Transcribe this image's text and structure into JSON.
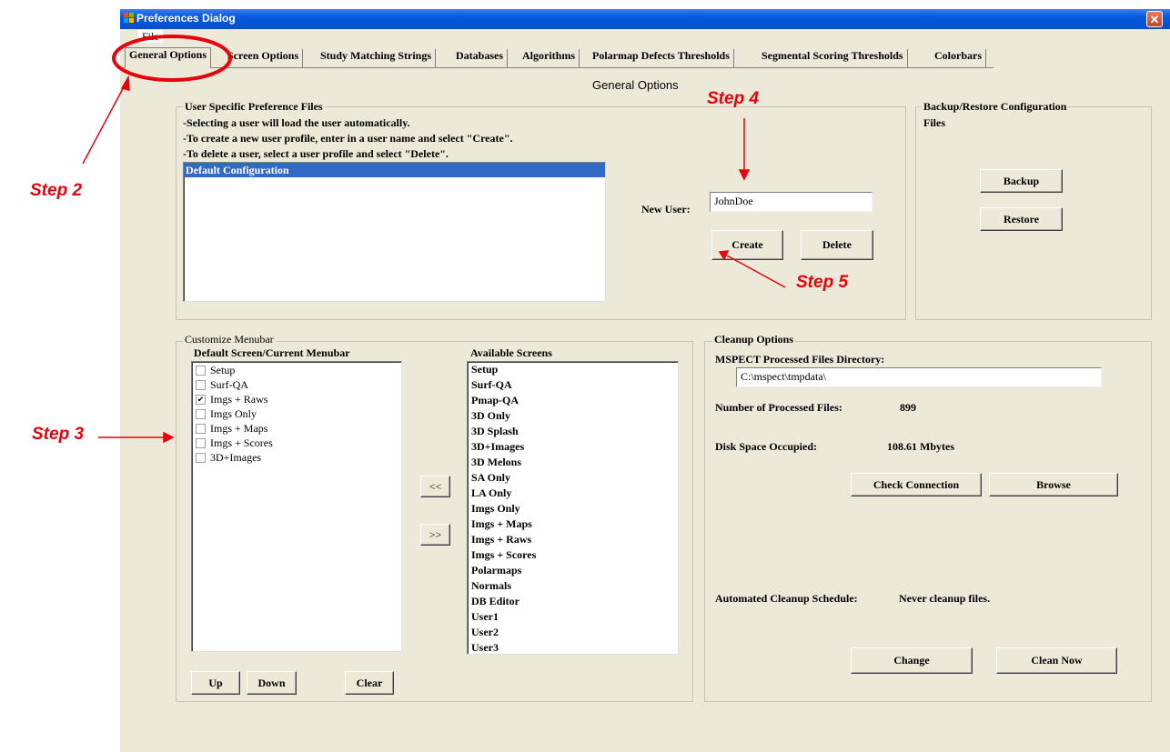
{
  "window": {
    "title": "Preferences Dialog",
    "close_glyph": "✕"
  },
  "menu": {
    "file": "File"
  },
  "tabs": [
    {
      "label": "General Options"
    },
    {
      "label": "Screen Options"
    },
    {
      "label": "Study Matching Strings"
    },
    {
      "label": "Databases"
    },
    {
      "label": "Algorithms"
    },
    {
      "label": "Polarmap Defects Thresholds"
    },
    {
      "label": "Segmental Scoring Thresholds"
    },
    {
      "label": "Colorbars"
    }
  ],
  "page_title": "General Options",
  "user_prefs": {
    "title": "User Specific Preference Files",
    "instructions": [
      "-Selecting a user will load the user automatically.",
      "-To create a new user profile, enter in a user name and select \"Create\".",
      "-To delete a user, select a user profile and select \"Delete\"."
    ],
    "users": [
      "Default Configuration"
    ],
    "new_user_label": "New User:",
    "new_user_value": "JohnDoe",
    "create_label": "Create",
    "delete_label": "Delete"
  },
  "backup": {
    "title_line1": "Backup/Restore Configuration",
    "title_line2": "Files",
    "backup_label": "Backup",
    "restore_label": "Restore"
  },
  "menubar": {
    "title": "Customize Menubar",
    "current_header": "Default Screen/Current Menubar",
    "current_items": [
      {
        "label": "Setup",
        "checked": false
      },
      {
        "label": "Surf-QA",
        "checked": false
      },
      {
        "label": "Imgs + Raws",
        "checked": true
      },
      {
        "label": "Imgs Only",
        "checked": false
      },
      {
        "label": "Imgs + Maps",
        "checked": false
      },
      {
        "label": "Imgs + Scores",
        "checked": false
      },
      {
        "label": "3D+Images",
        "checked": false
      }
    ],
    "available_header": "Available Screens",
    "available_items": [
      "Setup",
      "Surf-QA",
      "Pmap-QA",
      "3D Only",
      "3D Splash",
      "3D+Images",
      "3D Melons",
      "SA Only",
      "LA Only",
      "Imgs Only",
      "Imgs + Maps",
      "Imgs + Raws",
      "Imgs + Scores",
      "Polarmaps",
      "Normals",
      "DB Editor",
      "User1",
      "User2",
      "User3"
    ],
    "move_left_label": "<<",
    "move_right_label": ">>",
    "up_label": "Up",
    "down_label": "Down",
    "clear_label": "Clear"
  },
  "cleanup": {
    "title": "Cleanup Options",
    "dir_label": "MSPECT Processed Files Directory:",
    "dir_value": "C:\\mspect\\tmpdata\\",
    "num_files_label": "Number of Processed Files:",
    "num_files_value": "899",
    "disk_label": "Disk Space Occupied:",
    "disk_value": "108.61 Mbytes",
    "check_label": "Check Connection",
    "browse_label": "Browse",
    "schedule_label": "Automated Cleanup Schedule:",
    "schedule_value": "Never cleanup files.",
    "change_label": "Change",
    "clean_now_label": "Clean Now"
  },
  "annotations": {
    "step2": "Step 2",
    "step3": "Step 3",
    "step4": "Step 4",
    "step5": "Step 5",
    "color": "#e8000b"
  }
}
